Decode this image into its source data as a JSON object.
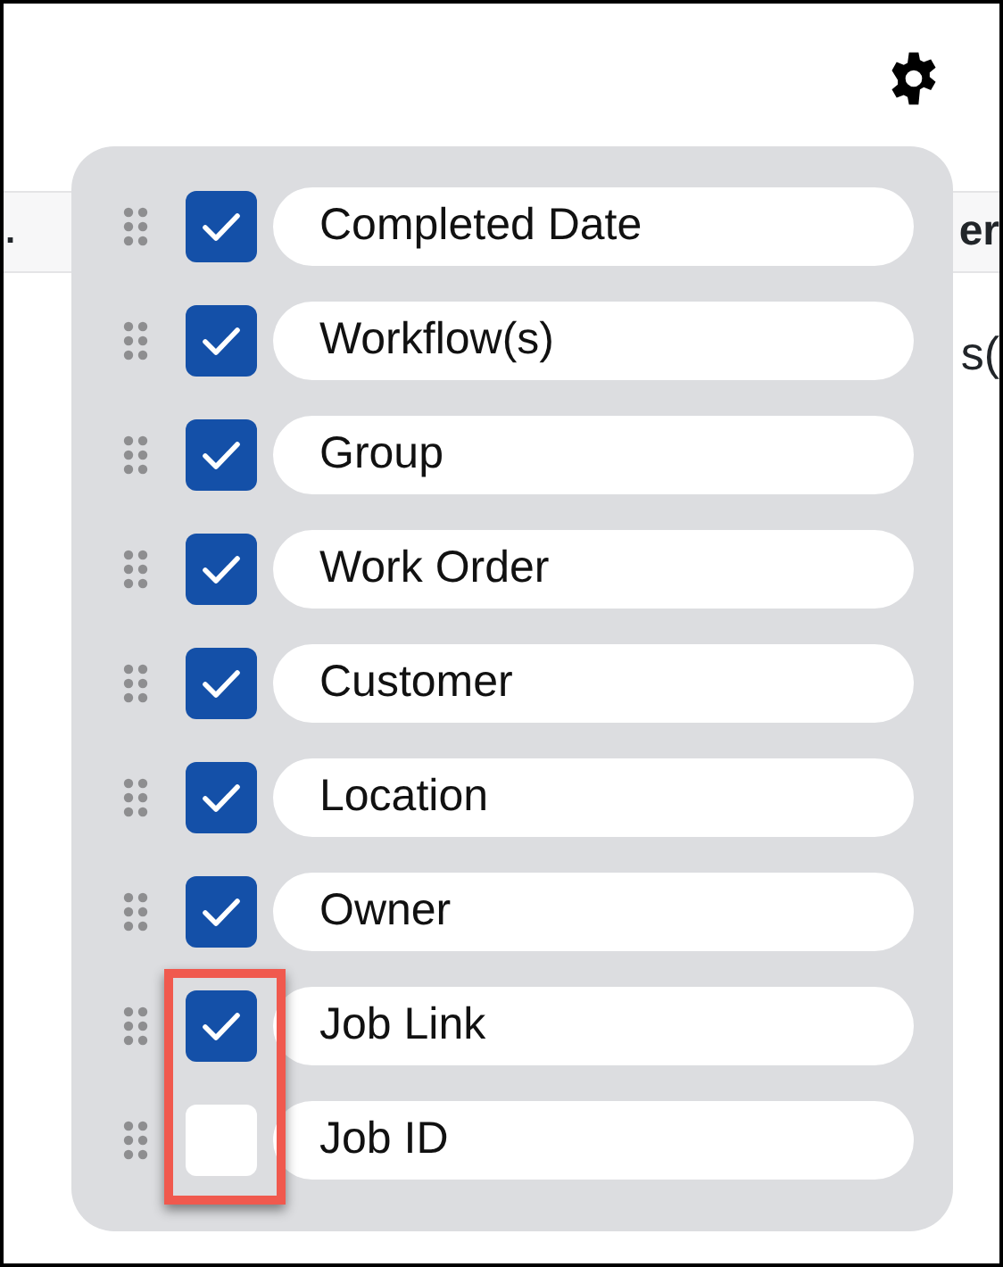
{
  "table": {
    "header_left": ".",
    "header_right": "er",
    "row_right": "s("
  },
  "column_menu": {
    "items": [
      {
        "label": "Completed Date",
        "checked": true,
        "highlighted": false
      },
      {
        "label": "Workflow(s)",
        "checked": true,
        "highlighted": false
      },
      {
        "label": "Group",
        "checked": true,
        "highlighted": false
      },
      {
        "label": "Work Order",
        "checked": true,
        "highlighted": false
      },
      {
        "label": "Customer",
        "checked": true,
        "highlighted": false
      },
      {
        "label": "Location",
        "checked": true,
        "highlighted": false
      },
      {
        "label": "Owner",
        "checked": true,
        "highlighted": false
      },
      {
        "label": "Job Link",
        "checked": true,
        "highlighted": true
      },
      {
        "label": "Job ID",
        "checked": false,
        "highlighted": true
      }
    ]
  }
}
